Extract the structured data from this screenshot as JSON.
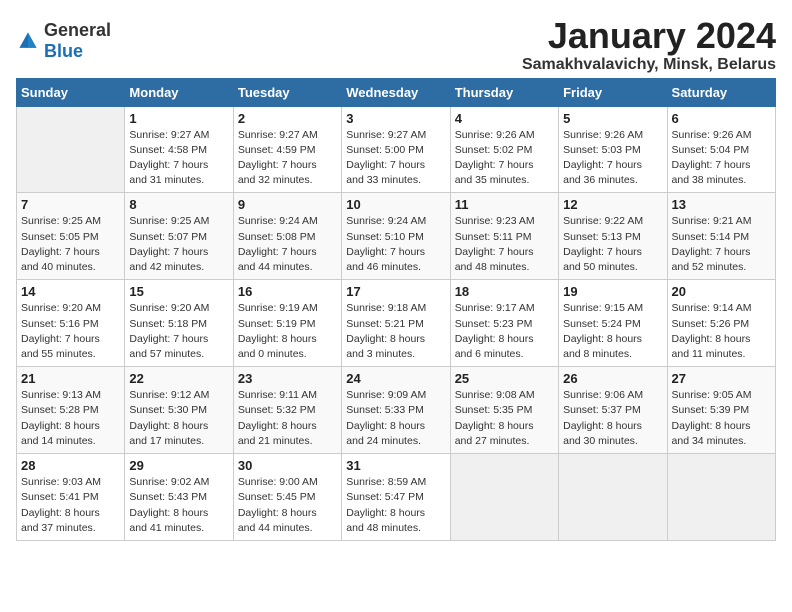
{
  "logo": {
    "text_general": "General",
    "text_blue": "Blue"
  },
  "calendar": {
    "title": "January 2024",
    "subtitle": "Samakhvalavichy, Minsk, Belarus",
    "headers": [
      "Sunday",
      "Monday",
      "Tuesday",
      "Wednesday",
      "Thursday",
      "Friday",
      "Saturday"
    ],
    "weeks": [
      [
        {
          "day": "",
          "info": ""
        },
        {
          "day": "1",
          "info": "Sunrise: 9:27 AM\nSunset: 4:58 PM\nDaylight: 7 hours\nand 31 minutes."
        },
        {
          "day": "2",
          "info": "Sunrise: 9:27 AM\nSunset: 4:59 PM\nDaylight: 7 hours\nand 32 minutes."
        },
        {
          "day": "3",
          "info": "Sunrise: 9:27 AM\nSunset: 5:00 PM\nDaylight: 7 hours\nand 33 minutes."
        },
        {
          "day": "4",
          "info": "Sunrise: 9:26 AM\nSunset: 5:02 PM\nDaylight: 7 hours\nand 35 minutes."
        },
        {
          "day": "5",
          "info": "Sunrise: 9:26 AM\nSunset: 5:03 PM\nDaylight: 7 hours\nand 36 minutes."
        },
        {
          "day": "6",
          "info": "Sunrise: 9:26 AM\nSunset: 5:04 PM\nDaylight: 7 hours\nand 38 minutes."
        }
      ],
      [
        {
          "day": "7",
          "info": "Sunrise: 9:25 AM\nSunset: 5:05 PM\nDaylight: 7 hours\nand 40 minutes."
        },
        {
          "day": "8",
          "info": "Sunrise: 9:25 AM\nSunset: 5:07 PM\nDaylight: 7 hours\nand 42 minutes."
        },
        {
          "day": "9",
          "info": "Sunrise: 9:24 AM\nSunset: 5:08 PM\nDaylight: 7 hours\nand 44 minutes."
        },
        {
          "day": "10",
          "info": "Sunrise: 9:24 AM\nSunset: 5:10 PM\nDaylight: 7 hours\nand 46 minutes."
        },
        {
          "day": "11",
          "info": "Sunrise: 9:23 AM\nSunset: 5:11 PM\nDaylight: 7 hours\nand 48 minutes."
        },
        {
          "day": "12",
          "info": "Sunrise: 9:22 AM\nSunset: 5:13 PM\nDaylight: 7 hours\nand 50 minutes."
        },
        {
          "day": "13",
          "info": "Sunrise: 9:21 AM\nSunset: 5:14 PM\nDaylight: 7 hours\nand 52 minutes."
        }
      ],
      [
        {
          "day": "14",
          "info": "Sunrise: 9:20 AM\nSunset: 5:16 PM\nDaylight: 7 hours\nand 55 minutes."
        },
        {
          "day": "15",
          "info": "Sunrise: 9:20 AM\nSunset: 5:18 PM\nDaylight: 7 hours\nand 57 minutes."
        },
        {
          "day": "16",
          "info": "Sunrise: 9:19 AM\nSunset: 5:19 PM\nDaylight: 8 hours\nand 0 minutes."
        },
        {
          "day": "17",
          "info": "Sunrise: 9:18 AM\nSunset: 5:21 PM\nDaylight: 8 hours\nand 3 minutes."
        },
        {
          "day": "18",
          "info": "Sunrise: 9:17 AM\nSunset: 5:23 PM\nDaylight: 8 hours\nand 6 minutes."
        },
        {
          "day": "19",
          "info": "Sunrise: 9:15 AM\nSunset: 5:24 PM\nDaylight: 8 hours\nand 8 minutes."
        },
        {
          "day": "20",
          "info": "Sunrise: 9:14 AM\nSunset: 5:26 PM\nDaylight: 8 hours\nand 11 minutes."
        }
      ],
      [
        {
          "day": "21",
          "info": "Sunrise: 9:13 AM\nSunset: 5:28 PM\nDaylight: 8 hours\nand 14 minutes."
        },
        {
          "day": "22",
          "info": "Sunrise: 9:12 AM\nSunset: 5:30 PM\nDaylight: 8 hours\nand 17 minutes."
        },
        {
          "day": "23",
          "info": "Sunrise: 9:11 AM\nSunset: 5:32 PM\nDaylight: 8 hours\nand 21 minutes."
        },
        {
          "day": "24",
          "info": "Sunrise: 9:09 AM\nSunset: 5:33 PM\nDaylight: 8 hours\nand 24 minutes."
        },
        {
          "day": "25",
          "info": "Sunrise: 9:08 AM\nSunset: 5:35 PM\nDaylight: 8 hours\nand 27 minutes."
        },
        {
          "day": "26",
          "info": "Sunrise: 9:06 AM\nSunset: 5:37 PM\nDaylight: 8 hours\nand 30 minutes."
        },
        {
          "day": "27",
          "info": "Sunrise: 9:05 AM\nSunset: 5:39 PM\nDaylight: 8 hours\nand 34 minutes."
        }
      ],
      [
        {
          "day": "28",
          "info": "Sunrise: 9:03 AM\nSunset: 5:41 PM\nDaylight: 8 hours\nand 37 minutes."
        },
        {
          "day": "29",
          "info": "Sunrise: 9:02 AM\nSunset: 5:43 PM\nDaylight: 8 hours\nand 41 minutes."
        },
        {
          "day": "30",
          "info": "Sunrise: 9:00 AM\nSunset: 5:45 PM\nDaylight: 8 hours\nand 44 minutes."
        },
        {
          "day": "31",
          "info": "Sunrise: 8:59 AM\nSunset: 5:47 PM\nDaylight: 8 hours\nand 48 minutes."
        },
        {
          "day": "",
          "info": ""
        },
        {
          "day": "",
          "info": ""
        },
        {
          "day": "",
          "info": ""
        }
      ]
    ]
  }
}
